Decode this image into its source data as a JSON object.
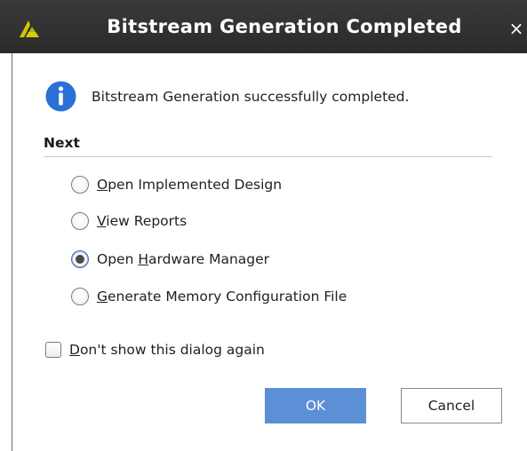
{
  "window": {
    "title": "Bitstream Generation Completed",
    "close_glyph": "×"
  },
  "message": {
    "icon": "info-icon",
    "text": "Bitstream Generation successfully completed."
  },
  "next_section": {
    "label": "Next",
    "options": [
      {
        "mnemonic": "O",
        "rest": "pen Implemented Design",
        "checked": false
      },
      {
        "mnemonic": "V",
        "rest": "iew Reports",
        "checked": false
      },
      {
        "prefix": "Open ",
        "mnemonic": "H",
        "rest": "ardware Manager",
        "checked": true
      },
      {
        "mnemonic": "G",
        "rest": "enerate Memory Configuration File",
        "checked": false
      }
    ]
  },
  "dont_show": {
    "mnemonic": "D",
    "rest": "on't show this dialog again",
    "checked": false
  },
  "buttons": {
    "ok_label": "OK",
    "cancel_label": "Cancel"
  },
  "colors": {
    "titlebar": "#2f2f2f",
    "info_icon": "#2a6fd6",
    "ok_button": "#5b8fd6",
    "vivado_logo": "#c8b400"
  }
}
